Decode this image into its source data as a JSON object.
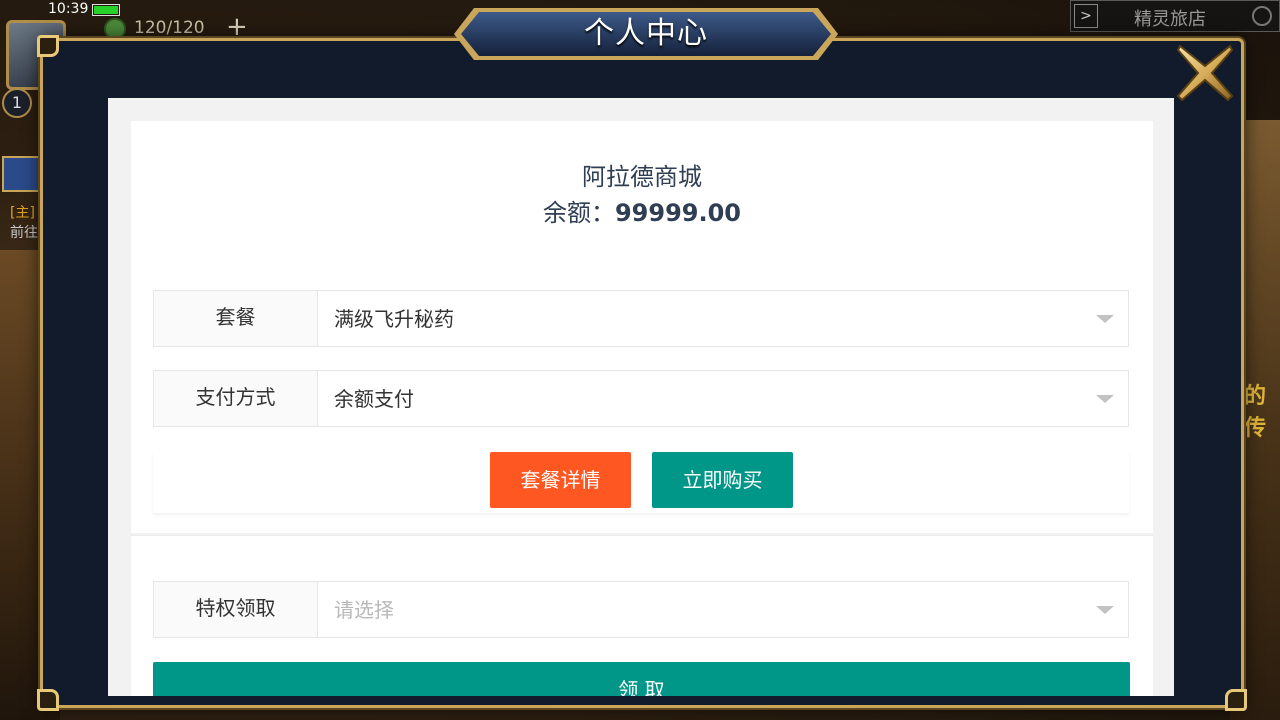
{
  "hud": {
    "time": "10:39",
    "energy": "120/120",
    "plus": "+",
    "level": "1",
    "quest_label": "[主]",
    "quest_sub": "前往",
    "shop_title": "精灵旅店",
    "shop_arrow": ">",
    "side_text": "的传"
  },
  "dialog": {
    "title": "个人中心"
  },
  "store": {
    "name": "阿拉德商城",
    "balance_label": "余额：",
    "balance_value": "99999.00"
  },
  "form": {
    "package": {
      "label": "套餐",
      "value": "满级飞升秘药"
    },
    "payment": {
      "label": "支付方式",
      "value": "余额支付"
    },
    "privilege": {
      "label": "特权领取",
      "placeholder": "请选择"
    }
  },
  "buttons": {
    "detail": "套餐详情",
    "buy": "立即购买",
    "claim": "领 取"
  },
  "colors": {
    "detail_button": "#ff5722",
    "primary_button": "#009688",
    "dialog_border": "#c9a659",
    "dialog_bg": "#111b2b"
  }
}
